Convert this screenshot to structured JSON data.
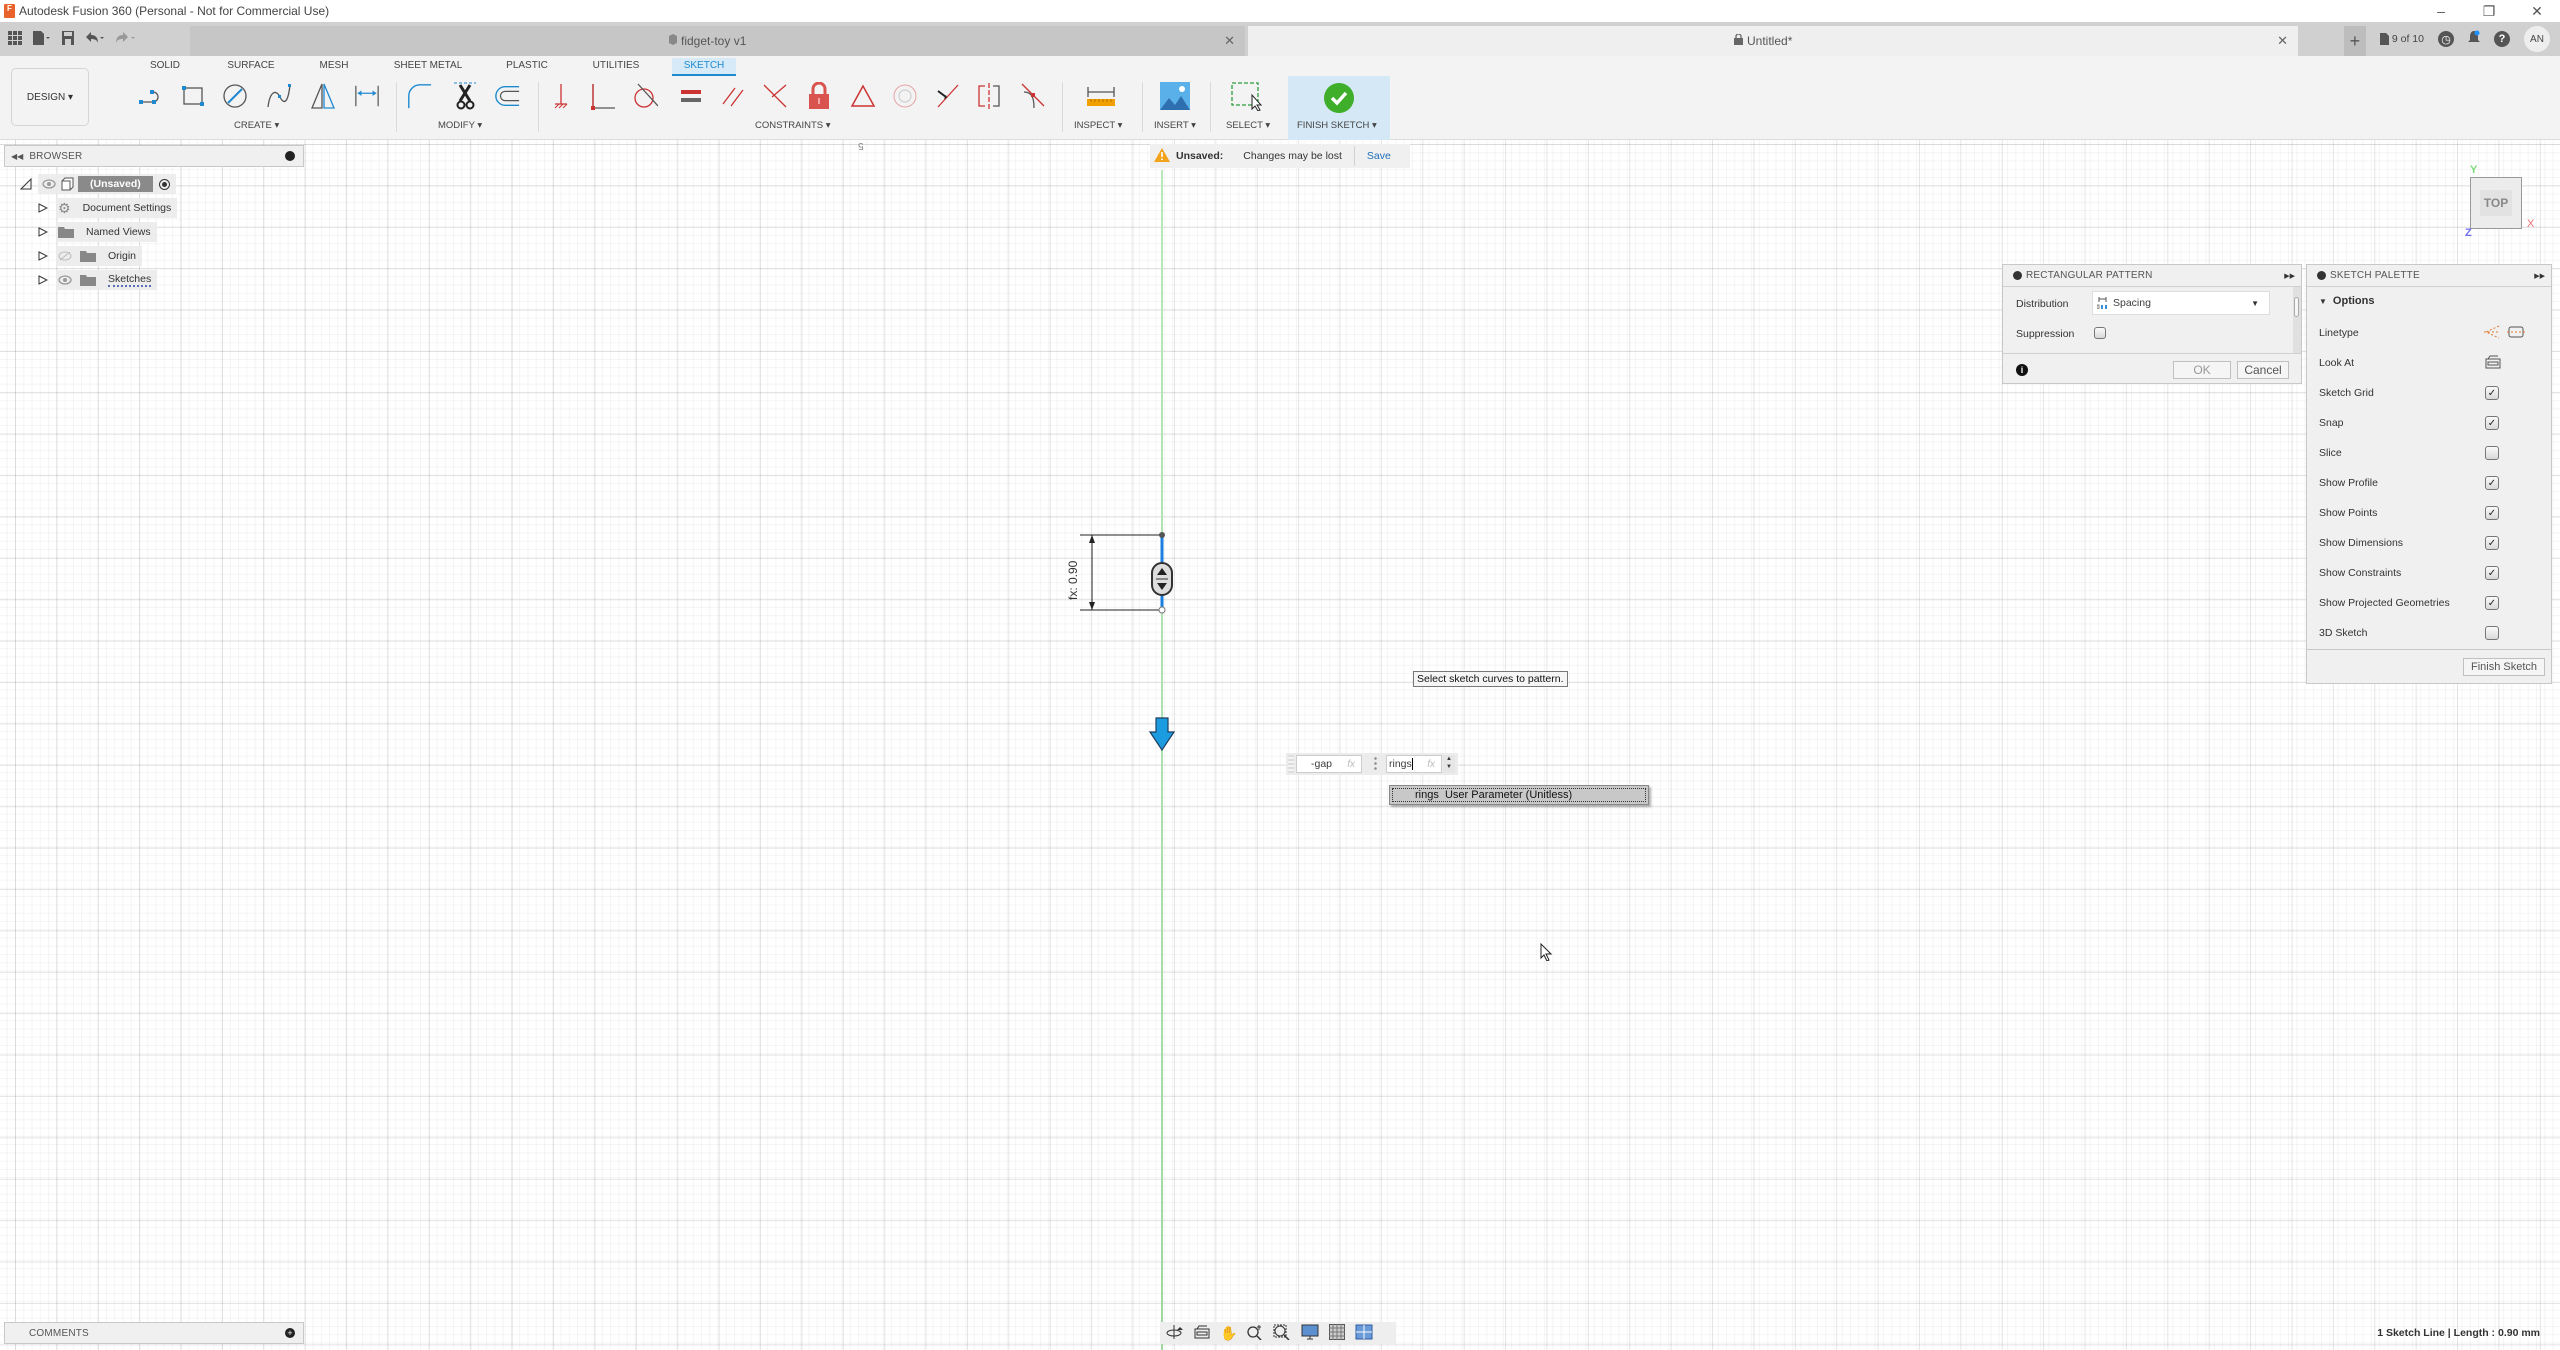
{
  "app": {
    "title": "Autodesk Fusion 360 (Personal - Not for Commercial Use)",
    "icon_letter": "F"
  },
  "window_controls": {
    "minimize": "–",
    "restore": "❐",
    "close": "✕"
  },
  "tabs": [
    {
      "label": "fidget-toy v1",
      "active": false
    },
    {
      "label": "Untitled*",
      "active": true
    }
  ],
  "tab_close": "✕",
  "tab_new": "+",
  "jobs": {
    "label": "9 of 10"
  },
  "user": {
    "initials": "AN"
  },
  "ribbon": {
    "workspace": "DESIGN ▾",
    "tabs": [
      "SOLID",
      "SURFACE",
      "MESH",
      "SHEET METAL",
      "PLASTIC",
      "UTILITIES",
      "SKETCH"
    ],
    "active_tab": "SKETCH",
    "groups": {
      "create": "CREATE ▾",
      "modify": "MODIFY ▾",
      "constraints": "CONSTRAINTS ▾",
      "inspect": "INSPECT ▾",
      "insert": "INSERT ▾",
      "select": "SELECT ▾",
      "finish": "FINISH SKETCH ▾"
    }
  },
  "browser": {
    "title": "BROWSER",
    "items": [
      {
        "label": "(Unsaved)"
      },
      {
        "label": "Document Settings"
      },
      {
        "label": "Named Views"
      },
      {
        "label": "Origin"
      },
      {
        "label": "Sketches"
      }
    ]
  },
  "unsaved_bar": {
    "label": "Unsaved:",
    "message": "Changes may be lost",
    "action": "Save"
  },
  "rectangular_pattern": {
    "title": "RECTANGULAR PATTERN",
    "distribution_label": "Distribution",
    "distribution_value": "Spacing",
    "suppression_label": "Suppression",
    "suppression_checked": false,
    "ok": "OK",
    "cancel": "Cancel"
  },
  "sketch_palette": {
    "title": "SKETCH PALETTE",
    "section": "Options",
    "rows": [
      {
        "label": "Linetype",
        "type": "icons"
      },
      {
        "label": "Look At",
        "type": "icon"
      },
      {
        "label": "Sketch Grid",
        "checked": true
      },
      {
        "label": "Snap",
        "checked": true
      },
      {
        "label": "Slice",
        "checked": false
      },
      {
        "label": "Show Profile",
        "checked": true
      },
      {
        "label": "Show Points",
        "checked": true
      },
      {
        "label": "Show Dimensions",
        "checked": true
      },
      {
        "label": "Show Constraints",
        "checked": true
      },
      {
        "label": "Show Projected Geometries",
        "checked": true
      },
      {
        "label": "3D Sketch",
        "checked": false
      }
    ],
    "finish": "Finish Sketch"
  },
  "canvas": {
    "dimension_label": "fx: 0.90",
    "ruler_mark": "5",
    "tooltip": "Select sketch curves to pattern.",
    "value_inputs": [
      {
        "value": "-gap",
        "fx": "fx"
      },
      {
        "value": "rings",
        "fx": "fx"
      }
    ],
    "autocomplete": {
      "name": "rings",
      "desc": "User Parameter (Unitless)"
    }
  },
  "viewcube": {
    "face": "TOP",
    "x": "X",
    "y": "Y",
    "z": "Z"
  },
  "comments": {
    "title": "COMMENTS"
  },
  "status": "1 Sketch Line | Length : 0.90 mm"
}
